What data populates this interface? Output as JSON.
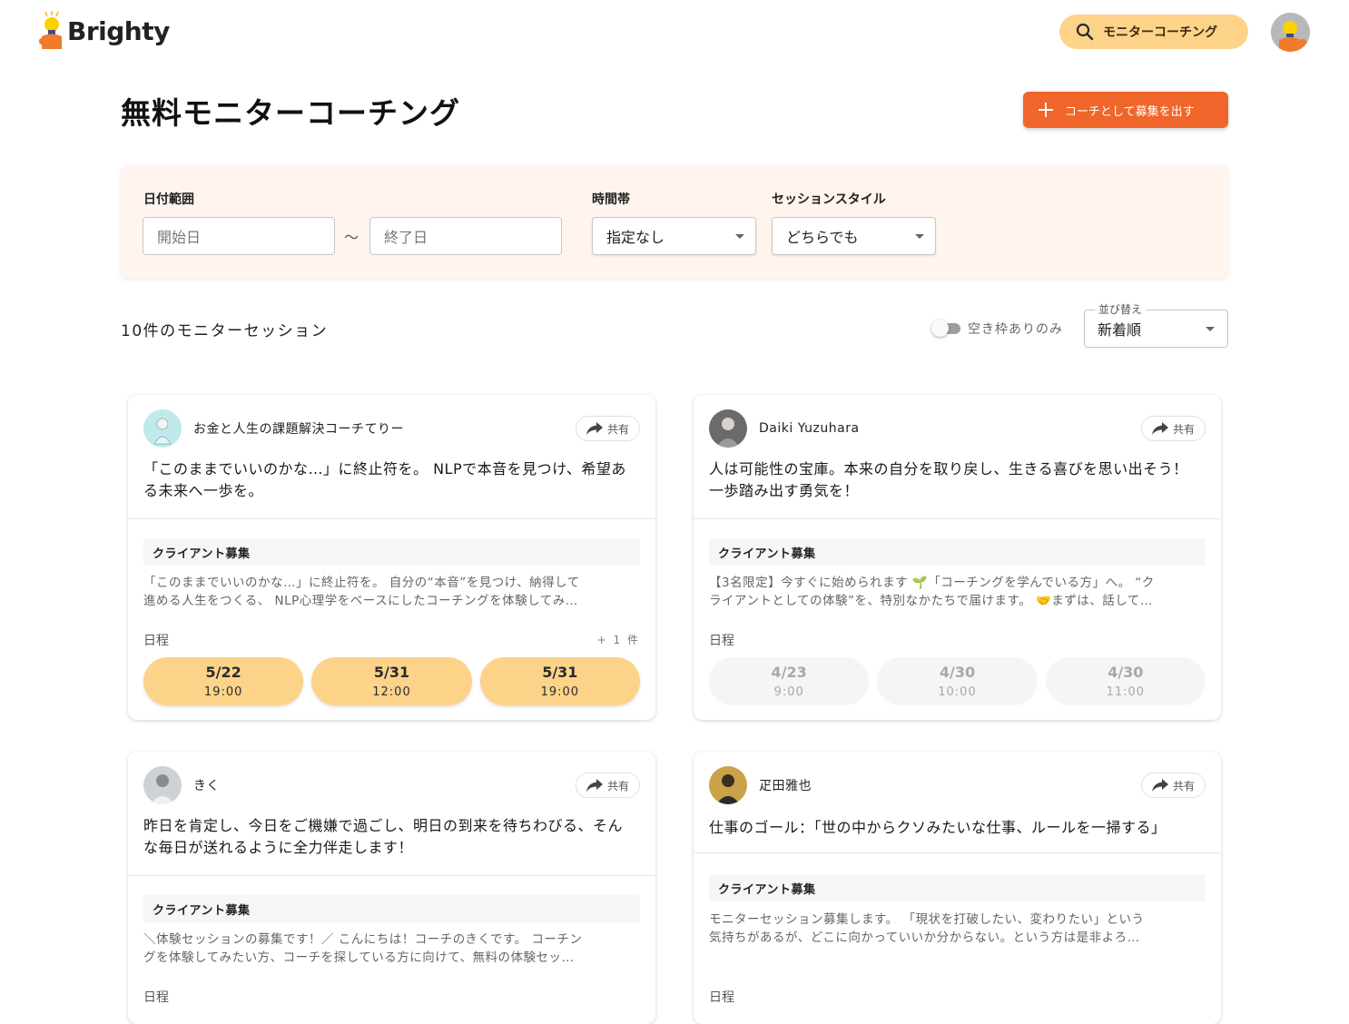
{
  "header": {
    "logo_text": "Brighty",
    "nav_button": "モニターコーチング"
  },
  "page": {
    "title": "無料モニターコーチング",
    "recruit_button": "コーチとして募集を出す"
  },
  "filters": {
    "date_range_label": "日付範囲",
    "start_placeholder": "開始日",
    "end_placeholder": "終了日",
    "separator": "〜",
    "time_label": "時間帯",
    "time_value": "指定なし",
    "style_label": "セッションスタイル",
    "style_value": "どちらでも"
  },
  "results": {
    "count_text": "10件のモニターセッション",
    "toggle_label": "空き枠ありのみ",
    "sort_label": "並び替え",
    "sort_value": "新着順"
  },
  "colors": {
    "accent_orange": "#f0662a",
    "slot_yellow": "#fdd38a",
    "panel_bg": "#fff4ee"
  },
  "cards": [
    {
      "name": "お金と人生の課題解決コーチてりー",
      "share": "共有",
      "headline": "「このままでいいのかな…」に終止符を。 NLPで本音を見つけ、希望ある未来へ一歩を。",
      "tag": "クライアント募集",
      "desc1": "「このままでいいのかな…」に終止符を。 自分の“本音”を見つけ、納得して",
      "desc2": "進める人生をつくる、 NLP心理学をベースにしたコーチングを体験してみ…",
      "schedule_label": "日程",
      "more": "+ 1 件",
      "slots": [
        {
          "date": "5/22",
          "time": "19:00"
        },
        {
          "date": "5/31",
          "time": "12:00"
        },
        {
          "date": "5/31",
          "time": "19:00"
        }
      ]
    },
    {
      "name": "Daiki Yuzuhara",
      "share": "共有",
      "headline": "人は可能性の宝庫。本来の自分を取り戻し、生きる喜びを思い出そう！一歩踏み出す勇気を！",
      "tag": "クライアント募集",
      "desc1": "【3名限定】今すぐに始められます 🌱「コーチングを学んでいる方」へ。 “ク",
      "desc2": "ライアントとしての体験”を、特別なかたちで届けます。 🤝まずは、話して…",
      "schedule_label": "日程",
      "slots": [
        {
          "date": "4/23",
          "time": "9:00"
        },
        {
          "date": "4/30",
          "time": "10:00"
        },
        {
          "date": "4/30",
          "time": "11:00"
        }
      ]
    },
    {
      "name": "きく",
      "share": "共有",
      "headline": "昨日を肯定し、今日をご機嫌で過ごし、明日の到来を待ちわびる、そんな毎日が送れるように全力伴走します！",
      "tag": "クライアント募集",
      "desc1": "＼体験セッションの募集です！／ こんにちは！コーチのきくです。 コーチン",
      "desc2": "グを体験してみたい方、コーチを探している方に向けて、無料の体験セッ…",
      "schedule_label": "日程"
    },
    {
      "name": "疋田雅也",
      "share": "共有",
      "headline": "仕事のゴール：「世の中からクソみたいな仕事、ルールを一掃する」",
      "tag": "クライアント募集",
      "desc1": "モニターセッション募集します。 「現状を打破したい、変わりたい」という",
      "desc2": "気持ちがあるが、どこに向かっていいか分からない。という方は是非よろ…",
      "schedule_label": "日程"
    }
  ]
}
